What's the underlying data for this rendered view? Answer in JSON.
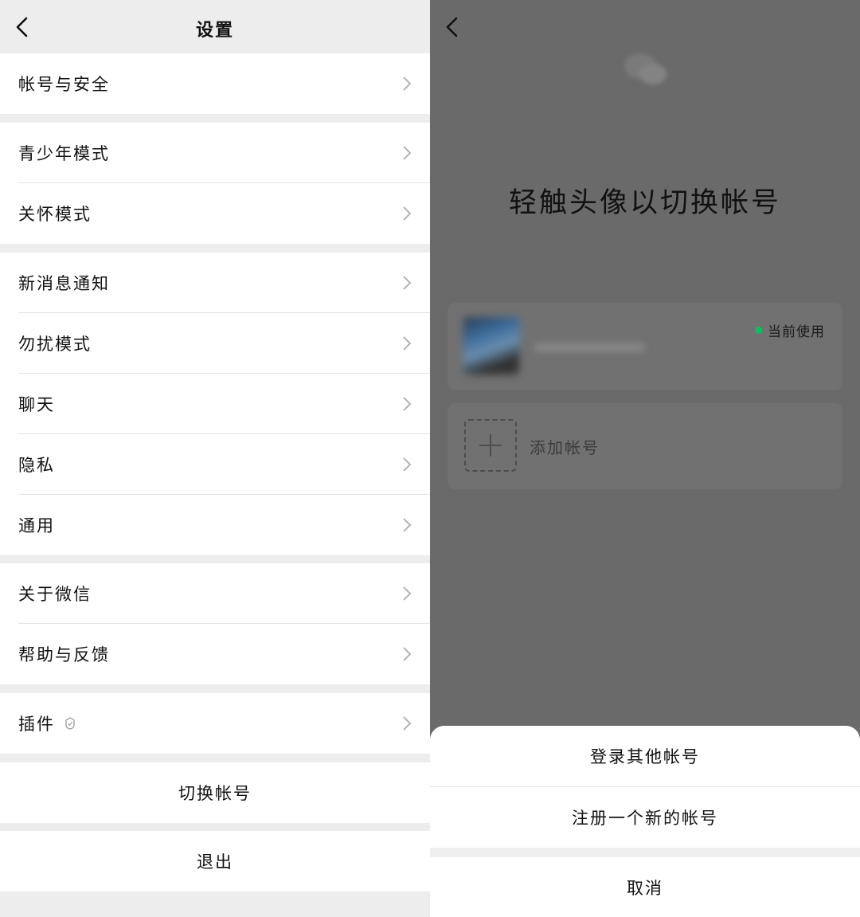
{
  "settings": {
    "title": "设置",
    "groups": [
      {
        "items": [
          {
            "label": "帐号与安全"
          }
        ]
      },
      {
        "items": [
          {
            "label": "青少年模式"
          },
          {
            "label": "关怀模式"
          }
        ]
      },
      {
        "items": [
          {
            "label": "新消息通知"
          },
          {
            "label": "勿扰模式"
          },
          {
            "label": "聊天"
          },
          {
            "label": "隐私"
          },
          {
            "label": "通用"
          }
        ]
      },
      {
        "items": [
          {
            "label": "关于微信"
          },
          {
            "label": "帮助与反馈"
          }
        ]
      },
      {
        "items": [
          {
            "label": "插件",
            "icon": "plugin-icon"
          }
        ]
      }
    ],
    "switch_account_label": "切换帐号",
    "logout_label": "退出"
  },
  "switch_panel": {
    "headline": "轻触头像以切换帐号",
    "current_account": {
      "status": "当前使用",
      "status_color": "#07c160"
    },
    "add_account_label": "添加帐号",
    "logo_icon": "wechat-logo-icon",
    "sheet": {
      "options": [
        "登录其他帐号",
        "注册一个新的帐号"
      ],
      "cancel_label": "取消"
    }
  },
  "colors": {
    "background": "#ededed",
    "card": "#ffffff",
    "overlay": "#6a6a6a",
    "accent": "#07c160"
  }
}
